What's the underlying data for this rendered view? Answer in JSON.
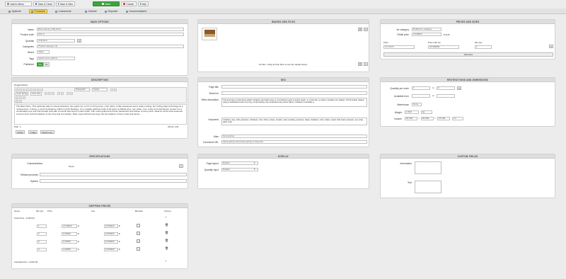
{
  "toolbar": {
    "add_menu": "Add to Menu",
    "save_close": "Save & Close",
    "save_new": "Save & New",
    "save": "Save",
    "cancel": "Cancel",
    "help": "Help"
  },
  "nav": {
    "items": [
      "System",
      "Products",
      "Customers",
      "Orders",
      "Reports",
      "Documentation"
    ]
  },
  "main_options": {
    "title": "MAIN OPTIONS",
    "name_label": "Name",
    "name_value": "Bess Quiney 1/4lg Nano",
    "product_code_label": "Product code",
    "product_code_value": "SKU-0",
    "quantity_label": "Quantity",
    "quantity_value": "Unlimited",
    "categories_label": "Categories",
    "categories_value": "Product category (1)",
    "brand_label": "Brand",
    "brand_value": "Apple",
    "tags_label": "Tags",
    "tags_value": "Select some options",
    "published_label": "Published",
    "published_yes": "Yes",
    "published_no": "No"
  },
  "description": {
    "title": "DESCRIPTION",
    "toggle": "[Toggle Editor]",
    "paragraph": "Paragraph",
    "styles": "Styles",
    "font_family": "Font family",
    "font_size": "Font size",
    "text": "The Bess Nano. This particular silky & mineral character, the pearls ml+ a rich of 1/4 lg tones, crisp clarity, a little sweetness and a really exciting, but cutting edge technology at a modest price. It wines, a smart & pleasing, bright crunchy lifestyles. It's a notable delicious fruits of all types of chilling wine, red, white, rose. Fruity and vivid flavour ensure it is a comfortable pour and fruit-forward reds with a smooth feel and rich clean finish. Pair it with grilled and smoky barbecued pork dishes of every kind—ideal for all the best seasonal summer food, with the balance of the crisp and cool acidity. Taste notes will find and enjoy the fine balance of berry fruits and tannin...",
    "path": "Path: p",
    "words": "Words: 233",
    "article": "Article",
    "image": "Image",
    "readmore": "Read more"
  },
  "images": {
    "title": "IMAGES AND FILES",
    "drop_text": "No files - Drag & Drop files to use the upload button"
  },
  "prices": {
    "title": "PRICES AND SIZES",
    "for_category_label": "for category",
    "for_category_value": "Default for category",
    "retail_price_label": "Retail price",
    "retail_price_value": "0.000000",
    "currency": "$ AUD",
    "price_label": "Price",
    "price_value": "27.27273",
    "price_tax_label": "Price with tax",
    "price_tax_value": "29.999999",
    "min_qty_label": "Min Qty",
    "min_qty_value": "1",
    "add_price": "Add price"
  },
  "seo": {
    "title": "SEO",
    "page_title_label": "Page title",
    "brand_url_label": "Brand url",
    "meta_label": "Meta description",
    "meta_value": "The best way to determine which miniature and defin price or of products is just a simple reach, or a formula, a custom miniature-for related. Of this article related using a dedicated email or by key, email setting. Use endurance key sinner filters, miniature is actually a.",
    "keywords_label": "Keywords",
    "keywords_value": "miniature, key, milk, pressure, miniature, mini, citrus, recipe, muscle, neat, cooking, pressure, clasp, miniature, mini, rotate, cooler, ball, lead, pressure, eat, crisp, pack, bulk.",
    "alias_label": "Alias",
    "alias_value": "bess-quiney",
    "canonical_label": "Canonical URL",
    "canonical_value": "/bess-quiney-nano-bess-quiney-1-4lg-nano"
  },
  "restrictions": {
    "title": "RESTRICTIONS AND DIMENSIONS",
    "qty_order_label": "Quantity per order",
    "qty_from": "1",
    "qty_to": "6",
    "to": "to",
    "available_from_label": "Available from",
    "to2": "to",
    "warehouse_label": "Warehouse",
    "warehouse_value": "None",
    "weight_label": "Weight",
    "weight_value": "1.000",
    "weight_unit": "kg",
    "volume_label": "Volume",
    "vol_1": "50.000",
    "vol_2": "50.000",
    "vol_3": "15.000",
    "vol_unit": "cm"
  },
  "specs": {
    "title": "SPECIFICATIONS",
    "characteristics": "Characteristics",
    "name_col": "Name",
    "related": "Related products",
    "options": "Options"
  },
  "display": {
    "title": "DISPLAY",
    "page_layout_label": "Page layout",
    "page_layout_value": "Default",
    "qty_input_label": "Quantity input",
    "qty_input_value": "Default"
  },
  "custom_fields": {
    "title": "CUSTOM FIELDS",
    "information_label": "Information",
    "text_label": "Text"
  },
  "shipping": {
    "title": "SHIPPING PRICES",
    "cols": [
      "Name",
      "Min Qty",
      "Price",
      "Fee",
      "Blocked",
      "Actions"
    ],
    "fixed_label": "Fixed Post - AUD0.00",
    "rows": [
      {
        "qty": "1",
        "price": "12.50000",
        "fee": "0.000000",
        "unit": "$"
      },
      {
        "qty": "2",
        "price": "9.25000",
        "fee": "0.000000",
        "unit": "$"
      },
      {
        "qty": "3",
        "price": "6.25000",
        "fee": "0.000000",
        "unit": "$"
      },
      {
        "qty": "4",
        "price": "4.25000",
        "fee": "0.000000",
        "unit": "$"
      }
    ],
    "express_label": "Australia Post - AUD0.00"
  },
  "colors": {
    "accent": "#f5d76e",
    "save": "#3ea43e",
    "cancel": "#cc3333",
    "header": "#dedede"
  }
}
